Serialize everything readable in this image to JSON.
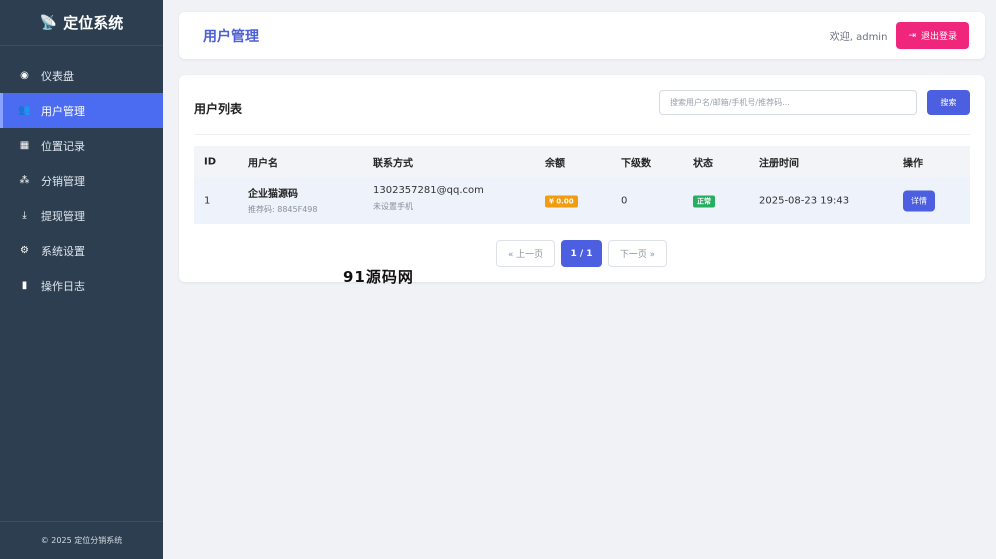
{
  "sidebar": {
    "brand": "定位系统",
    "items": [
      {
        "label": "仪表盘",
        "icon": "dashboard-icon",
        "glyph": "◉",
        "active": false
      },
      {
        "label": "用户管理",
        "icon": "users-icon",
        "glyph": "👥",
        "active": true
      },
      {
        "label": "位置记录",
        "icon": "map-icon",
        "glyph": "▦",
        "active": false
      },
      {
        "label": "分销管理",
        "icon": "sitemap-icon",
        "glyph": "⁂",
        "active": false
      },
      {
        "label": "提现管理",
        "icon": "withdraw-icon",
        "glyph": "⤓",
        "active": false
      },
      {
        "label": "系统设置",
        "icon": "cogs-icon",
        "glyph": "⚙",
        "active": false
      },
      {
        "label": "操作日志",
        "icon": "file-icon",
        "glyph": "▮",
        "active": false
      }
    ],
    "footer": "© 2025 定位分销系统"
  },
  "header": {
    "title": "用户管理",
    "welcome": "欢迎, admin",
    "logout_label": "退出登录"
  },
  "list": {
    "title": "用户列表",
    "search_placeholder": "搜索用户名/邮箱/手机号/推荐码...",
    "search_label": "搜索",
    "columns": [
      "ID",
      "用户名",
      "联系方式",
      "余额",
      "下级数",
      "状态",
      "注册时间",
      "操作"
    ],
    "rows": [
      {
        "id": "1",
        "username": "企业猫源码",
        "ref_code": "推荐码: 8845F498",
        "email": "1302357281@qq.com",
        "phone": "未设置手机",
        "balance": "¥ 0.00",
        "subordinates": "0",
        "status": "正常",
        "registered": "2025-08-23 19:43",
        "action": "详情"
      }
    ]
  },
  "pagination": {
    "prev": "« 上一页",
    "current": "1 / 1",
    "next": "下一页 »"
  },
  "watermark": "91源码网",
  "colors": {
    "sidebar_bg": "#2c3e50",
    "primary": "#4b5fe0",
    "logout": "#f0267c",
    "balance_badge": "#f39c12",
    "status_badge": "#27ae60"
  }
}
